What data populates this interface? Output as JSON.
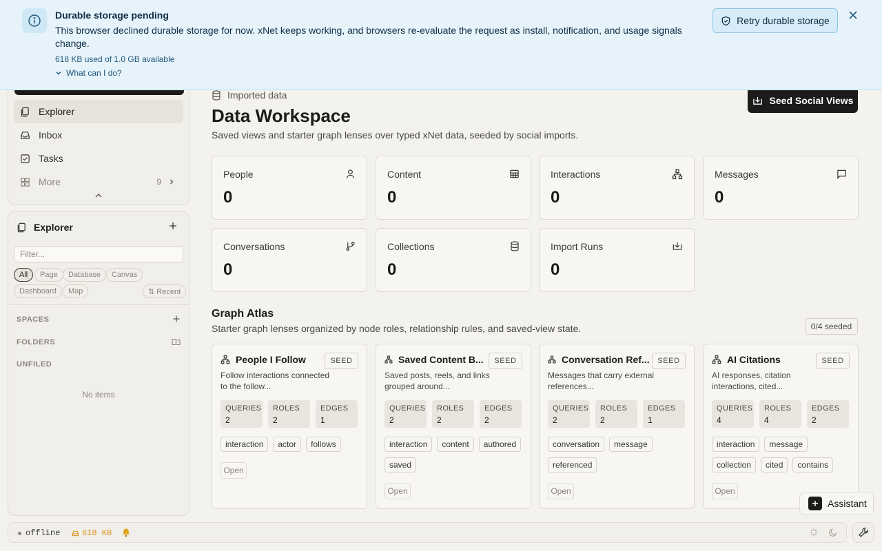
{
  "banner": {
    "title": "Durable storage pending",
    "message": "This browser declined durable storage for now. xNet keeps working, and browsers re-evaluate the request as install, notification, and usage signals change.",
    "usage": "618 KB used of 1.0 GB available",
    "help_link": "What can I do?",
    "retry_label": "Retry durable storage",
    "icon": "info-icon",
    "accent": "#e6f3fb"
  },
  "nav": {
    "items": [
      {
        "label": "Explorer",
        "icon": "pages-icon"
      },
      {
        "label": "Inbox",
        "icon": "inbox-icon"
      },
      {
        "label": "Tasks",
        "icon": "checkbox-icon"
      },
      {
        "label": "More",
        "icon": "grid-icon",
        "badge": "9"
      }
    ]
  },
  "explorer": {
    "title": "Explorer",
    "filter_placeholder": "Filter...",
    "chips": [
      "All",
      "Page",
      "Database",
      "Canvas",
      "Dashboard",
      "Map"
    ],
    "recent_label": "⇅ Recent",
    "sections": {
      "spaces": "SPACES",
      "folders": "FOLDERS",
      "unfiled": "UNFILED"
    },
    "empty": "No items"
  },
  "main": {
    "crumb": "Imported data",
    "title": "Data Workspace",
    "subtitle": "Saved views and starter graph lenses over typed xNet data, seeded by social imports.",
    "seed_button": "Seed Social Views",
    "stats": [
      {
        "label": "People",
        "value": "0",
        "icon": "person-icon"
      },
      {
        "label": "Content",
        "value": "0",
        "icon": "table-icon"
      },
      {
        "label": "Interactions",
        "value": "0",
        "icon": "network-icon"
      },
      {
        "label": "Messages",
        "value": "0",
        "icon": "message-icon"
      },
      {
        "label": "Conversations",
        "value": "0",
        "icon": "branch-icon"
      },
      {
        "label": "Collections",
        "value": "0",
        "icon": "database-icon"
      },
      {
        "label": "Import Runs",
        "value": "0",
        "icon": "import-icon"
      }
    ],
    "atlas": {
      "title": "Graph Atlas",
      "subtitle": "Starter graph lenses organized by node roles, relationship rules, and saved-view state.",
      "badge": "0/4 seeded",
      "metric_labels": [
        "QUERIES",
        "ROLES",
        "EDGES"
      ],
      "seed_label": "SEED",
      "open_label": "Open",
      "lenses": [
        {
          "title": "People I Follow",
          "desc": "Follow interactions connected to the follow...",
          "queries": "2",
          "roles": "2",
          "edges": "1",
          "tags": [
            "interaction",
            "actor",
            "follows"
          ]
        },
        {
          "title": "Saved Content B...",
          "desc": "Saved posts, reels, and links grouped around...",
          "queries": "2",
          "roles": "2",
          "edges": "2",
          "tags": [
            "interaction",
            "content",
            "authored",
            "saved"
          ]
        },
        {
          "title": "Conversation Ref...",
          "desc": "Messages that carry external references...",
          "queries": "2",
          "roles": "2",
          "edges": "1",
          "tags": [
            "conversation",
            "message",
            "referenced"
          ]
        },
        {
          "title": "AI Citations",
          "desc": "AI responses, citation interactions, cited...",
          "queries": "4",
          "roles": "4",
          "edges": "2",
          "tags": [
            "interaction",
            "message",
            "collection",
            "cited",
            "contains"
          ]
        }
      ]
    },
    "assistant_label": "Assistant"
  },
  "status": {
    "connection": "offline",
    "storage": "618 KB",
    "storage_color": "#d9921c"
  }
}
